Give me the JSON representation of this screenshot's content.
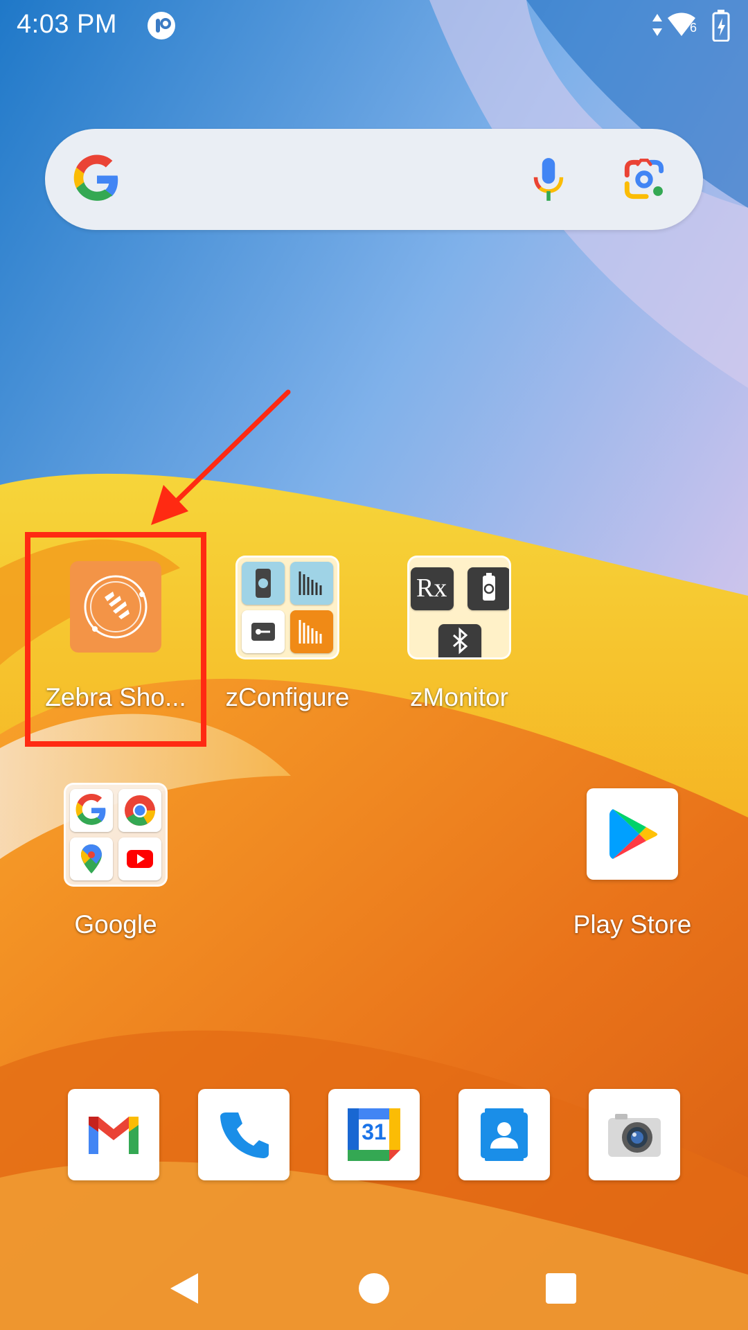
{
  "status_bar": {
    "time": "4:03 PM",
    "network_type": "6",
    "icons": [
      "app-badge-icon",
      "data-arrows-icon",
      "wifi-icon",
      "battery-charging-icon"
    ]
  },
  "search": {
    "logo": "google-g-icon",
    "icons": [
      "microphone-icon",
      "google-lens-icon"
    ]
  },
  "apps": [
    {
      "label": "Zebra Sho...",
      "icon": "zebra-showcase-icon",
      "highlighted": true
    },
    {
      "label": "zConfigure",
      "icon": "folder-icon"
    },
    {
      "label": "zMonitor",
      "icon": "folder-icon"
    },
    {
      "label": "Google",
      "icon": "folder-icon"
    },
    {
      "label": "Play Store",
      "icon": "play-store-icon"
    }
  ],
  "dock": [
    "gmail-icon",
    "phone-icon",
    "calendar-icon",
    "contacts-icon",
    "camera-icon"
  ],
  "calendar_day": "31",
  "zmonitor_rx": "Rx",
  "nav": [
    "back-icon",
    "home-icon",
    "recents-icon"
  ],
  "colors": {
    "annotation_red": "#ff2a12",
    "zebra_orange": "#f39447",
    "google_blue": "#4285f4",
    "google_red": "#ea4335",
    "google_yellow": "#fbbc05",
    "google_green": "#34a853"
  }
}
